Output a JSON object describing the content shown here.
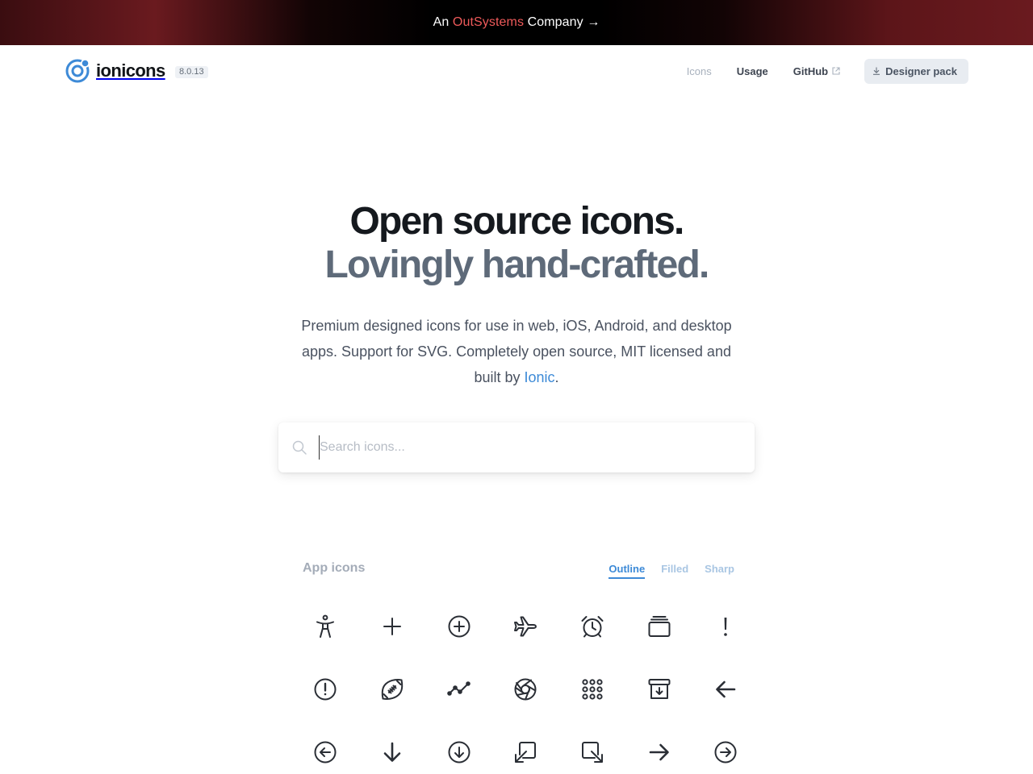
{
  "banner": {
    "prefix": "An",
    "brand": "OutSystems",
    "suffix": "Company →"
  },
  "header": {
    "logo_text": "ionicons",
    "version": "8.0.13",
    "nav": [
      {
        "label": "Icons"
      },
      {
        "label": "Usage"
      },
      {
        "label": "GitHub"
      }
    ],
    "designer_pack": "Designer pack"
  },
  "hero": {
    "title_line1": "Open source icons.",
    "title_line2": "Lovingly hand-crafted.",
    "desc_before": "Premium designed icons for use in web, iOS, Android, and desktop apps. Support for SVG. Completely open source, MIT licensed and built by",
    "desc_link": "Ionic",
    "desc_after": "."
  },
  "search": {
    "placeholder": "Search icons..."
  },
  "icons_section": {
    "title": "App icons",
    "tabs": [
      {
        "label": "Outline",
        "active": true
      },
      {
        "label": "Filled",
        "active": false
      },
      {
        "label": "Sharp",
        "active": false
      }
    ],
    "icons": [
      "accessibility-icon",
      "add-icon",
      "add-circle-icon",
      "airplane-icon",
      "alarm-icon",
      "albums-icon",
      "alert-icon",
      "alert-circle-icon",
      "american-football-icon",
      "analytics-icon",
      "aperture-icon",
      "apps-icon",
      "archive-icon",
      "arrow-back-icon",
      "arrow-back-circle-icon",
      "arrow-down-icon",
      "arrow-down-circle-icon",
      "arrow-down-left-box-icon",
      "arrow-down-right-box-icon",
      "arrow-forward-icon",
      "arrow-forward-circle-icon"
    ]
  },
  "colors": {
    "accent": "#3d8ad7",
    "brand_red": "#ee5a5a",
    "title_dark": "#15191e",
    "title_muted": "#5e6a79"
  }
}
